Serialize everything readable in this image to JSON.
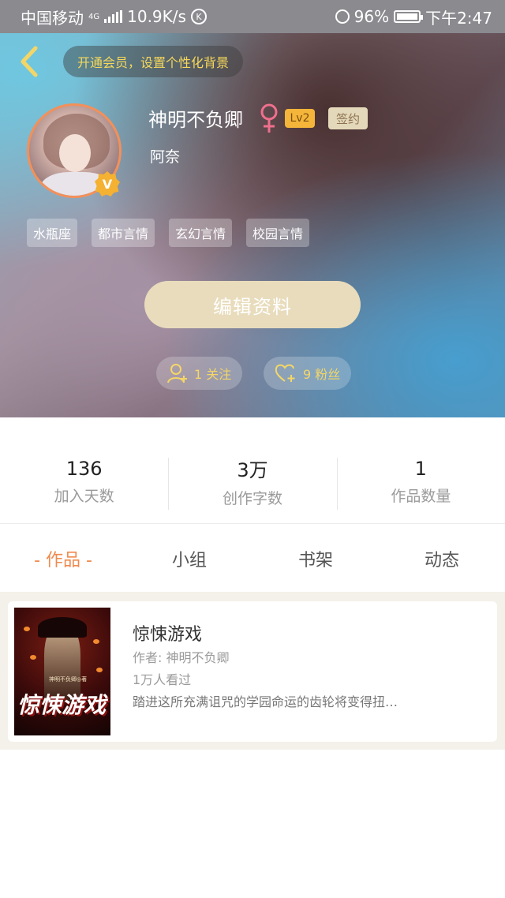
{
  "status_bar": {
    "carrier": "中国移动",
    "network": "4G",
    "speed": "10.9K/s",
    "k_icon_label": "K",
    "battery": "96%",
    "time": "下午2:47"
  },
  "header": {
    "vip_banner": "开通会员，设置个性化背景",
    "username": "神明不负卿",
    "gender_icon": "female-icon",
    "level": "Lv2",
    "sign_badge": "签约",
    "subname": "阿奈",
    "verify_badge": "V",
    "tags": [
      "水瓶座",
      "都市言情",
      "玄幻言情",
      "校园言情"
    ],
    "edit_button": "编辑资料",
    "follow": "1 关注",
    "fans": "9 粉丝"
  },
  "stats": [
    {
      "value": "136",
      "label": "加入天数"
    },
    {
      "value": "3万",
      "label": "创作字数"
    },
    {
      "value": "1",
      "label": "作品数量"
    }
  ],
  "tabs": [
    {
      "label": "- 作品 -",
      "active": true
    },
    {
      "label": "小组",
      "active": false
    },
    {
      "label": "书架",
      "active": false
    },
    {
      "label": "动态",
      "active": false
    }
  ],
  "work": {
    "title": "惊悚游戏",
    "author": "作者: 神明不负卿",
    "views": "1万人看过",
    "description": "踏进这所充满诅咒的学园命运的齿轮将变得扭…",
    "cover_title": "惊悚游戏",
    "cover_author": "神明不负卿◎著"
  },
  "colors": {
    "accent": "#f08a4f",
    "gold": "#f4d667",
    "edit_button": "#e8dcbc"
  }
}
